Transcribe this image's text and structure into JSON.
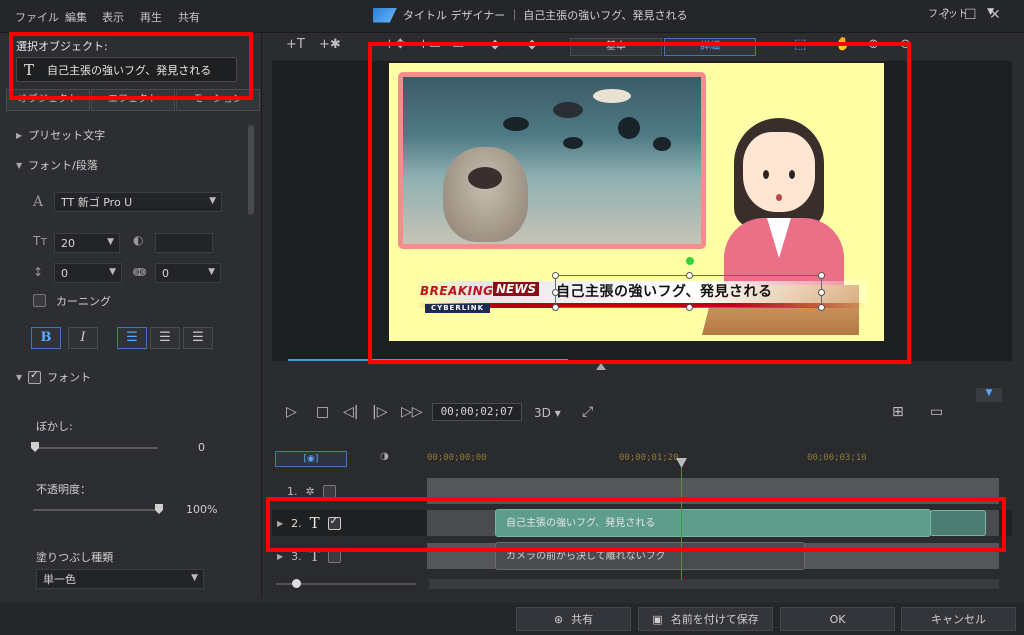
{
  "menu": [
    "ファイル",
    "編集",
    "表示",
    "再生",
    "共有"
  ],
  "window_title": "タイトル デザイナー ｜ 自己主張の強いフグ、発見される",
  "window_controls": {
    "help": "?",
    "maximize": "☐",
    "close": "✕"
  },
  "left_panel": {
    "selected_label": "選択オブジェクト:",
    "selected_value": "自己主張の強いフグ、発見される",
    "tabs": [
      "オブジェクト",
      "エフェクト",
      "モーション"
    ],
    "preset_section": "プリセット文字",
    "font_section": "フォント/段落",
    "font_name": "TT 新ゴ Pro U",
    "font_size": "20",
    "line_spacing": "0",
    "char_spacing": "0",
    "kerning_label": "カーニング",
    "bold": "B",
    "italic": "I",
    "font_fill_section": "フォント",
    "blur_label": "ぼかし:",
    "blur_value": "0",
    "opacity_label": "不透明度：",
    "opacity_value": "100%",
    "fill_type_label": "塗りつぶし種類",
    "fill_type_value": "単一色"
  },
  "preview_toolbar": {
    "tab_basic": "基本",
    "tab_detail": "詳細",
    "fit": "フィット"
  },
  "canvas": {
    "breaking": "BREAKING",
    "news": "NEWS",
    "cyberlink": "CYBERLINK",
    "headline": "自己主張の強いフグ、発見される"
  },
  "playback": {
    "timecode": "00;00;02;07",
    "mode_3d": "3D"
  },
  "timeline": {
    "ticks": [
      "00;00;00;00",
      "00;00;01;20",
      "00;00;03;10"
    ],
    "tracks": [
      {
        "index": "1.",
        "checked": true
      },
      {
        "index": "2.",
        "checked": true
      },
      {
        "index": "3.",
        "checked": false
      }
    ],
    "clip_main": "自己主張の強いフグ、発見される",
    "clip_sub": "カメラの前から決して離れないフグ"
  },
  "bottom_bar": {
    "share": "共有",
    "save_as": "名前を付けて保存",
    "ok": "OK",
    "cancel": "キャンセル"
  },
  "colors": {
    "highlight_red": "#ff0000",
    "clip_teal": "#5e9c8c",
    "canvas_bg": "#ffffa6"
  }
}
